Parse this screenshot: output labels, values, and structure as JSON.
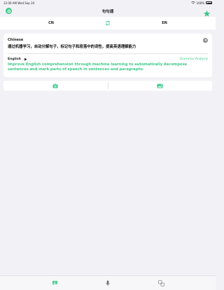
{
  "status": {
    "time": "12:00 AM",
    "date": "Wed Sep 24",
    "battery": "100%"
  },
  "nav": {
    "title": "句句通"
  },
  "languages": {
    "source": "CN",
    "target": "EN"
  },
  "card": {
    "source_lang": "Chinese",
    "source_text": "通过机器学习，自动分解句子，标记句子和段落中的词性，提高英语理解能力",
    "target_lang": "English",
    "grammar_link": "Grammar Analysis",
    "result_text": "Improve English comprehension through machine learning to automatically decompose sentences and mark parts of speech in sentences and paragraphs"
  },
  "colors": {
    "accent": "#3cc98a",
    "background": "#f2f2f6"
  },
  "icons": {
    "nav_left": "settings-icon",
    "nav_right": "star-icon",
    "swap": "swap-icon",
    "action_left": "camera-icon",
    "action_right": "gallery-icon",
    "tabs": [
      "chat-icon",
      "microphone-icon",
      "translate-icon"
    ]
  }
}
